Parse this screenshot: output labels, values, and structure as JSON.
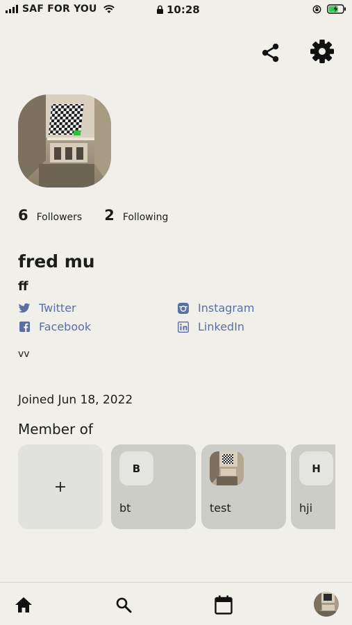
{
  "status_bar": {
    "carrier": "SAF FOR YOU",
    "time": "10:28"
  },
  "header": {
    "share_icon": "share-icon",
    "settings_icon": "gear-icon"
  },
  "profile": {
    "followers_count": "6",
    "followers_label": "Followers",
    "following_count": "2",
    "following_label": "Following",
    "name": "fred mu",
    "handle": "ff",
    "bio": "vv",
    "joined": "Joined Jun 18, 2022"
  },
  "social": {
    "twitter": "Twitter",
    "facebook": "Facebook",
    "instagram": "Instagram",
    "linkedin": "LinkedIn",
    "link_color": "#5a6fa4"
  },
  "member_of": {
    "title": "Member of",
    "add_label": "+",
    "groups": [
      {
        "initial": "B",
        "name": "bt"
      },
      {
        "initial": "",
        "name": "test"
      },
      {
        "initial": "H",
        "name": "hji"
      }
    ]
  },
  "tabbar": {
    "items": [
      "home-icon",
      "search-icon",
      "calendar-icon",
      "profile-avatar"
    ]
  },
  "colors": {
    "background": "#f0efe9",
    "card": "#cdcdc7",
    "add_card": "#e1e1de"
  }
}
